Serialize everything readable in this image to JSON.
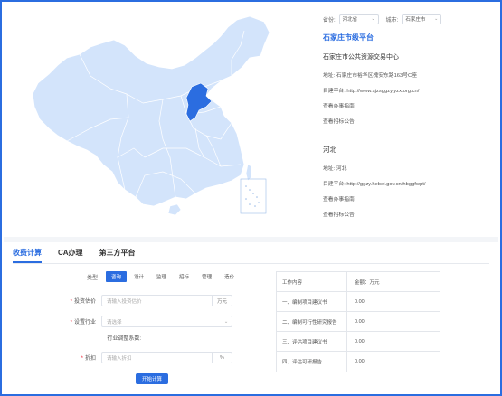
{
  "map": {
    "colors": {
      "land": "#d3e4fb",
      "border": "#ffffff",
      "highlight": "#2b6de0"
    }
  },
  "selectors": {
    "province_label": "省份:",
    "province_value": "河北省",
    "city_label": "城市:",
    "city_value": "石家庄市"
  },
  "city_platform": {
    "title": "石家庄市级平台",
    "org_name": "石家庄市公共资源交易中心",
    "address": "地址:  石家庄市裕华区槐安东路163号C座",
    "website": "目建平台:  http://www.sjzsggzyjyzx.org.cn/",
    "guide_link": "查看办事指南",
    "notice_link": "查看招标公告"
  },
  "province_platform": {
    "title": "河北",
    "address": "地址:  河北",
    "website": "目建平台:  http://ggzy.hebei.gov.cn/hbggfwpt/",
    "guide_link": "查看办事指南",
    "notice_link": "查看招标公告"
  },
  "tabs": [
    {
      "label": "收费计算",
      "active": true
    },
    {
      "label": "CA办理",
      "active": false
    },
    {
      "label": "第三方平台",
      "active": false
    }
  ],
  "form": {
    "type_label": "类型",
    "types": [
      {
        "label": "咨询",
        "active": true
      },
      {
        "label": "设计",
        "active": false
      },
      {
        "label": "监理",
        "active": false
      },
      {
        "label": "招标",
        "active": false
      },
      {
        "label": "管理",
        "active": false
      },
      {
        "label": "造价",
        "active": false
      }
    ],
    "investment_label": "投资估价",
    "investment_placeholder": "请输入投资估价",
    "investment_unit": "万元",
    "industry_label": "设置行业",
    "industry_placeholder": "请选择",
    "industry_coef_label": "行业调整系数:",
    "discount_label": "折扣",
    "discount_placeholder": "请输入折扣",
    "discount_unit": "%",
    "calc_button": "开始计算"
  },
  "result_table": {
    "header": {
      "col1": "工作内容",
      "col2": "金额：万元"
    },
    "rows": [
      {
        "item": "一、编制项目建议书",
        "amount": "0.00"
      },
      {
        "item": "二、编制可行性研究报告",
        "amount": "0.00"
      },
      {
        "item": "三、评估项目建议书",
        "amount": "0.00"
      },
      {
        "item": "四、评估可研报告",
        "amount": "0.00"
      }
    ]
  }
}
